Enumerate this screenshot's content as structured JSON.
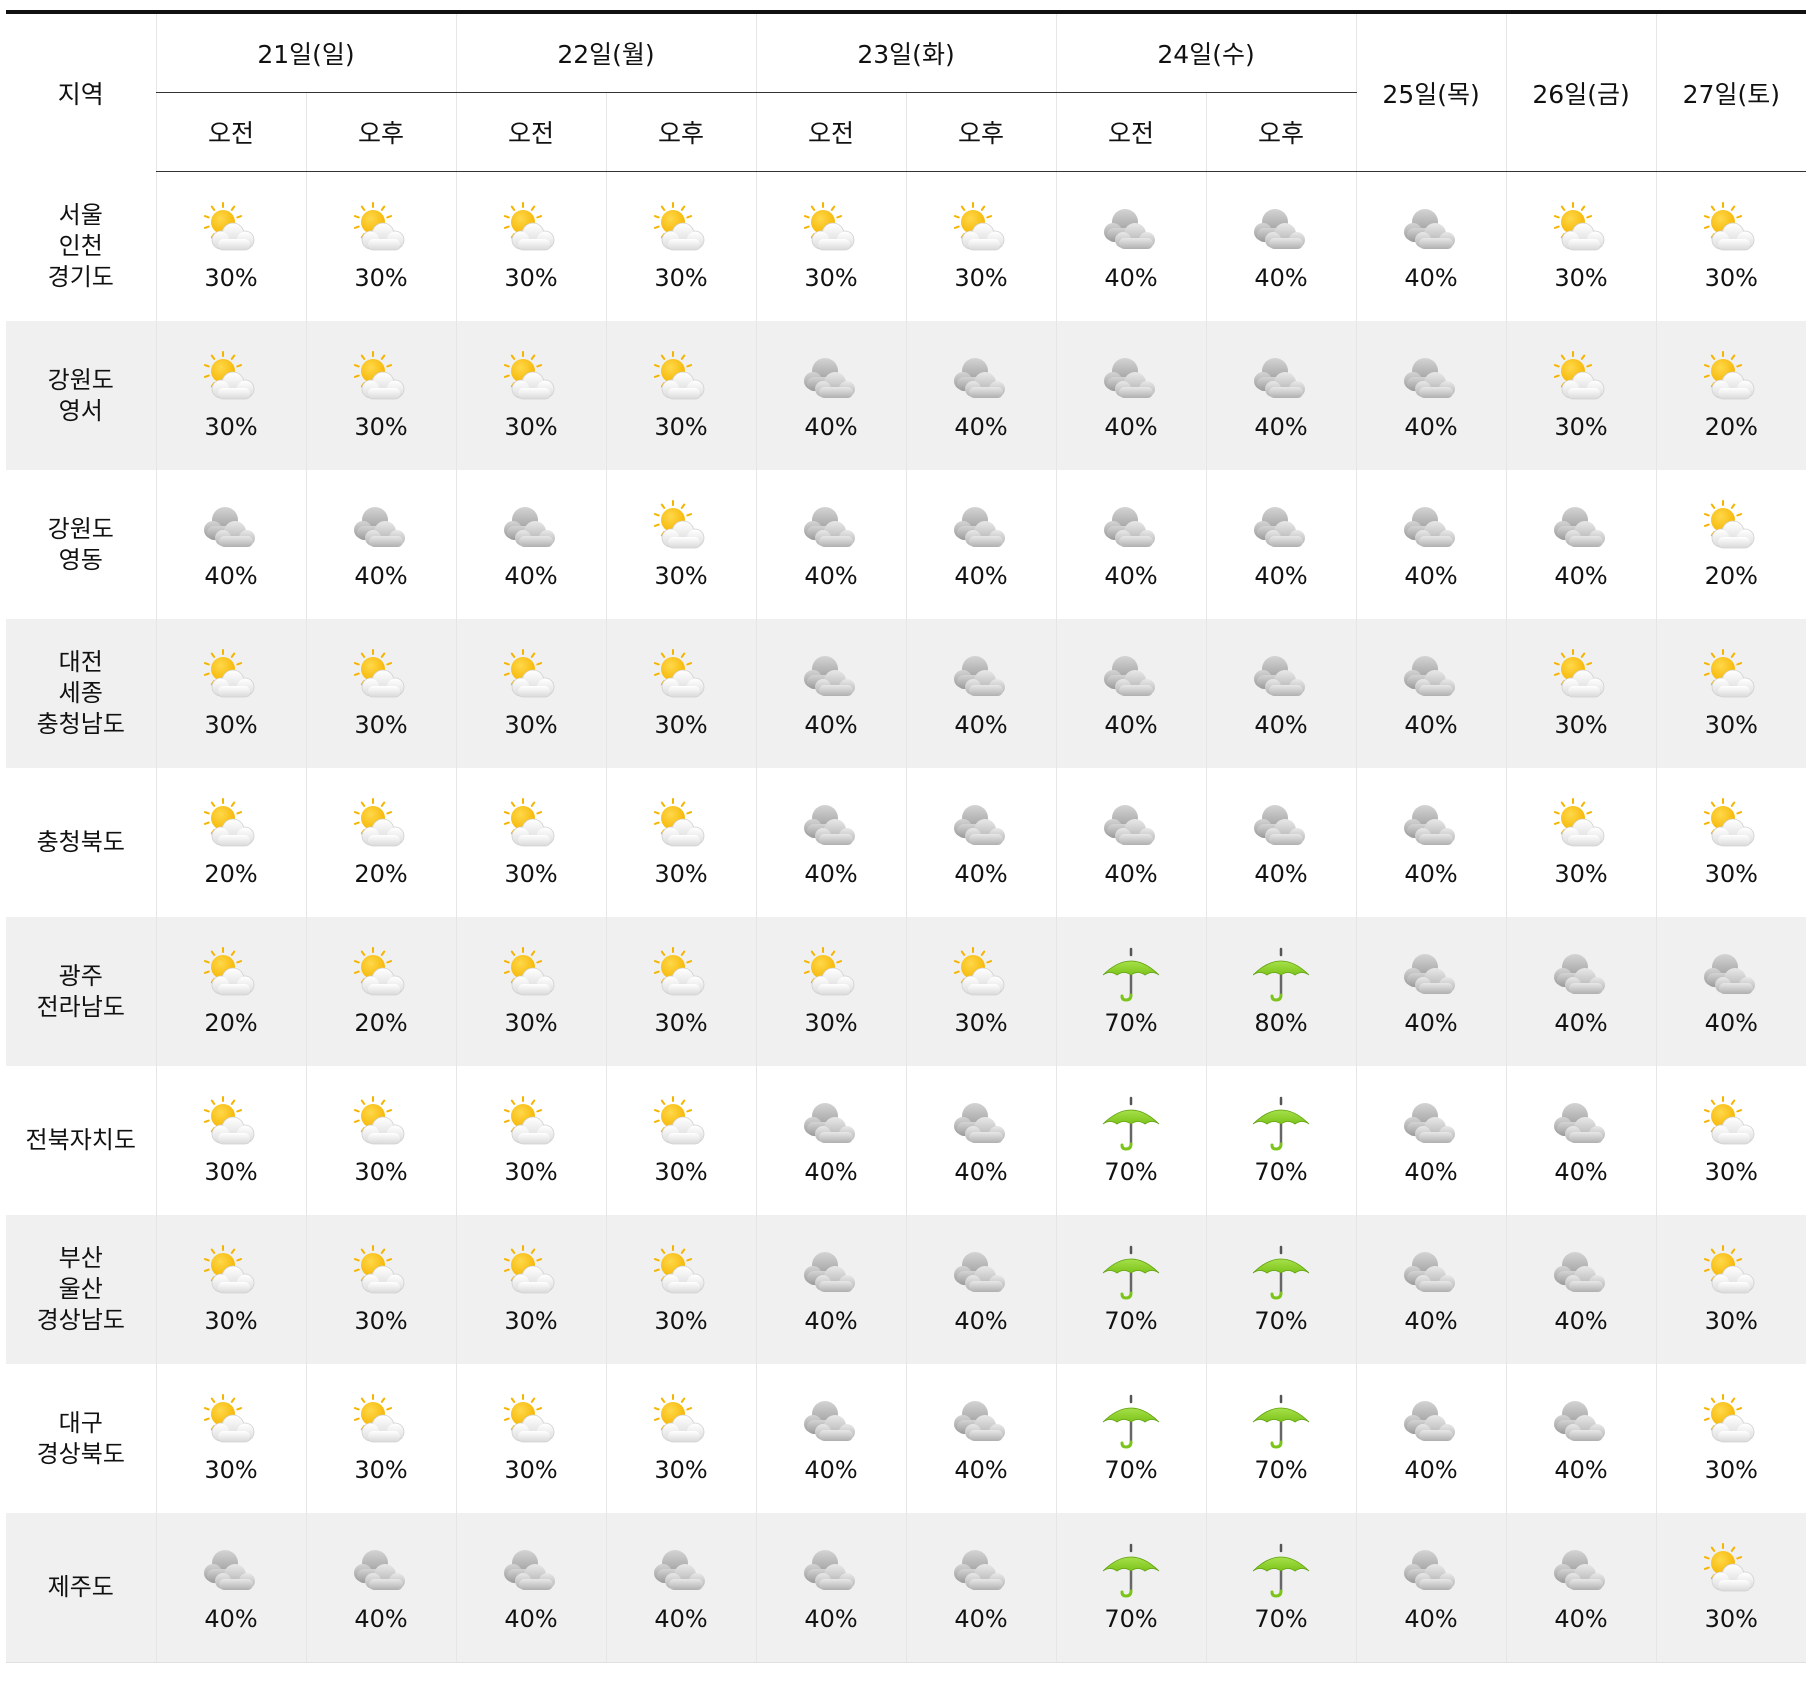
{
  "header": {
    "region": "지역",
    "ampm_days": [
      "21일(일)",
      "22일(월)",
      "23일(화)",
      "24일(수)"
    ],
    "am": "오전",
    "pm": "오후",
    "single_days": [
      "25일(목)",
      "26일(금)",
      "27일(토)"
    ]
  },
  "icons": {
    "partly-cloudy": "partly-cloudy-icon",
    "cloudy": "cloudy-icon",
    "rain": "umbrella-icon"
  },
  "colors": {
    "sun": "#f5b400",
    "cloud": "#b8b8b8",
    "umbrella": "#7cc41a",
    "row_alt": "#f0f0f0"
  },
  "rows": [
    {
      "region": [
        "서울",
        "인천",
        "경기도"
      ],
      "cells": [
        [
          "partly-cloudy",
          "30%"
        ],
        [
          "partly-cloudy",
          "30%"
        ],
        [
          "partly-cloudy",
          "30%"
        ],
        [
          "partly-cloudy",
          "30%"
        ],
        [
          "partly-cloudy",
          "30%"
        ],
        [
          "partly-cloudy",
          "30%"
        ],
        [
          "cloudy",
          "40%"
        ],
        [
          "cloudy",
          "40%"
        ],
        [
          "cloudy",
          "40%"
        ],
        [
          "partly-cloudy",
          "30%"
        ],
        [
          "partly-cloudy",
          "30%"
        ]
      ]
    },
    {
      "region": [
        "강원도",
        "영서"
      ],
      "cells": [
        [
          "partly-cloudy",
          "30%"
        ],
        [
          "partly-cloudy",
          "30%"
        ],
        [
          "partly-cloudy",
          "30%"
        ],
        [
          "partly-cloudy",
          "30%"
        ],
        [
          "cloudy",
          "40%"
        ],
        [
          "cloudy",
          "40%"
        ],
        [
          "cloudy",
          "40%"
        ],
        [
          "cloudy",
          "40%"
        ],
        [
          "cloudy",
          "40%"
        ],
        [
          "partly-cloudy",
          "30%"
        ],
        [
          "partly-cloudy",
          "20%"
        ]
      ]
    },
    {
      "region": [
        "강원도",
        "영동"
      ],
      "cells": [
        [
          "cloudy",
          "40%"
        ],
        [
          "cloudy",
          "40%"
        ],
        [
          "cloudy",
          "40%"
        ],
        [
          "partly-cloudy",
          "30%"
        ],
        [
          "cloudy",
          "40%"
        ],
        [
          "cloudy",
          "40%"
        ],
        [
          "cloudy",
          "40%"
        ],
        [
          "cloudy",
          "40%"
        ],
        [
          "cloudy",
          "40%"
        ],
        [
          "cloudy",
          "40%"
        ],
        [
          "partly-cloudy",
          "20%"
        ]
      ]
    },
    {
      "region": [
        "대전",
        "세종",
        "충청남도"
      ],
      "cells": [
        [
          "partly-cloudy",
          "30%"
        ],
        [
          "partly-cloudy",
          "30%"
        ],
        [
          "partly-cloudy",
          "30%"
        ],
        [
          "partly-cloudy",
          "30%"
        ],
        [
          "cloudy",
          "40%"
        ],
        [
          "cloudy",
          "40%"
        ],
        [
          "cloudy",
          "40%"
        ],
        [
          "cloudy",
          "40%"
        ],
        [
          "cloudy",
          "40%"
        ],
        [
          "partly-cloudy",
          "30%"
        ],
        [
          "partly-cloudy",
          "30%"
        ]
      ]
    },
    {
      "region": [
        "충청북도"
      ],
      "cells": [
        [
          "partly-cloudy",
          "20%"
        ],
        [
          "partly-cloudy",
          "20%"
        ],
        [
          "partly-cloudy",
          "30%"
        ],
        [
          "partly-cloudy",
          "30%"
        ],
        [
          "cloudy",
          "40%"
        ],
        [
          "cloudy",
          "40%"
        ],
        [
          "cloudy",
          "40%"
        ],
        [
          "cloudy",
          "40%"
        ],
        [
          "cloudy",
          "40%"
        ],
        [
          "partly-cloudy",
          "30%"
        ],
        [
          "partly-cloudy",
          "30%"
        ]
      ]
    },
    {
      "region": [
        "광주",
        "전라남도"
      ],
      "cells": [
        [
          "partly-cloudy",
          "20%"
        ],
        [
          "partly-cloudy",
          "20%"
        ],
        [
          "partly-cloudy",
          "30%"
        ],
        [
          "partly-cloudy",
          "30%"
        ],
        [
          "partly-cloudy",
          "30%"
        ],
        [
          "partly-cloudy",
          "30%"
        ],
        [
          "rain",
          "70%"
        ],
        [
          "rain",
          "80%"
        ],
        [
          "cloudy",
          "40%"
        ],
        [
          "cloudy",
          "40%"
        ],
        [
          "cloudy",
          "40%"
        ]
      ]
    },
    {
      "region": [
        "전북자치도"
      ],
      "cells": [
        [
          "partly-cloudy",
          "30%"
        ],
        [
          "partly-cloudy",
          "30%"
        ],
        [
          "partly-cloudy",
          "30%"
        ],
        [
          "partly-cloudy",
          "30%"
        ],
        [
          "cloudy",
          "40%"
        ],
        [
          "cloudy",
          "40%"
        ],
        [
          "rain",
          "70%"
        ],
        [
          "rain",
          "70%"
        ],
        [
          "cloudy",
          "40%"
        ],
        [
          "cloudy",
          "40%"
        ],
        [
          "partly-cloudy",
          "30%"
        ]
      ]
    },
    {
      "region": [
        "부산",
        "울산",
        "경상남도"
      ],
      "cells": [
        [
          "partly-cloudy",
          "30%"
        ],
        [
          "partly-cloudy",
          "30%"
        ],
        [
          "partly-cloudy",
          "30%"
        ],
        [
          "partly-cloudy",
          "30%"
        ],
        [
          "cloudy",
          "40%"
        ],
        [
          "cloudy",
          "40%"
        ],
        [
          "rain",
          "70%"
        ],
        [
          "rain",
          "70%"
        ],
        [
          "cloudy",
          "40%"
        ],
        [
          "cloudy",
          "40%"
        ],
        [
          "partly-cloudy",
          "30%"
        ]
      ]
    },
    {
      "region": [
        "대구",
        "경상북도"
      ],
      "cells": [
        [
          "partly-cloudy",
          "30%"
        ],
        [
          "partly-cloudy",
          "30%"
        ],
        [
          "partly-cloudy",
          "30%"
        ],
        [
          "partly-cloudy",
          "30%"
        ],
        [
          "cloudy",
          "40%"
        ],
        [
          "cloudy",
          "40%"
        ],
        [
          "rain",
          "70%"
        ],
        [
          "rain",
          "70%"
        ],
        [
          "cloudy",
          "40%"
        ],
        [
          "cloudy",
          "40%"
        ],
        [
          "partly-cloudy",
          "30%"
        ]
      ]
    },
    {
      "region": [
        "제주도"
      ],
      "cells": [
        [
          "cloudy",
          "40%"
        ],
        [
          "cloudy",
          "40%"
        ],
        [
          "cloudy",
          "40%"
        ],
        [
          "cloudy",
          "40%"
        ],
        [
          "cloudy",
          "40%"
        ],
        [
          "cloudy",
          "40%"
        ],
        [
          "rain",
          "70%"
        ],
        [
          "rain",
          "70%"
        ],
        [
          "cloudy",
          "40%"
        ],
        [
          "cloudy",
          "40%"
        ],
        [
          "partly-cloudy",
          "30%"
        ]
      ]
    }
  ]
}
